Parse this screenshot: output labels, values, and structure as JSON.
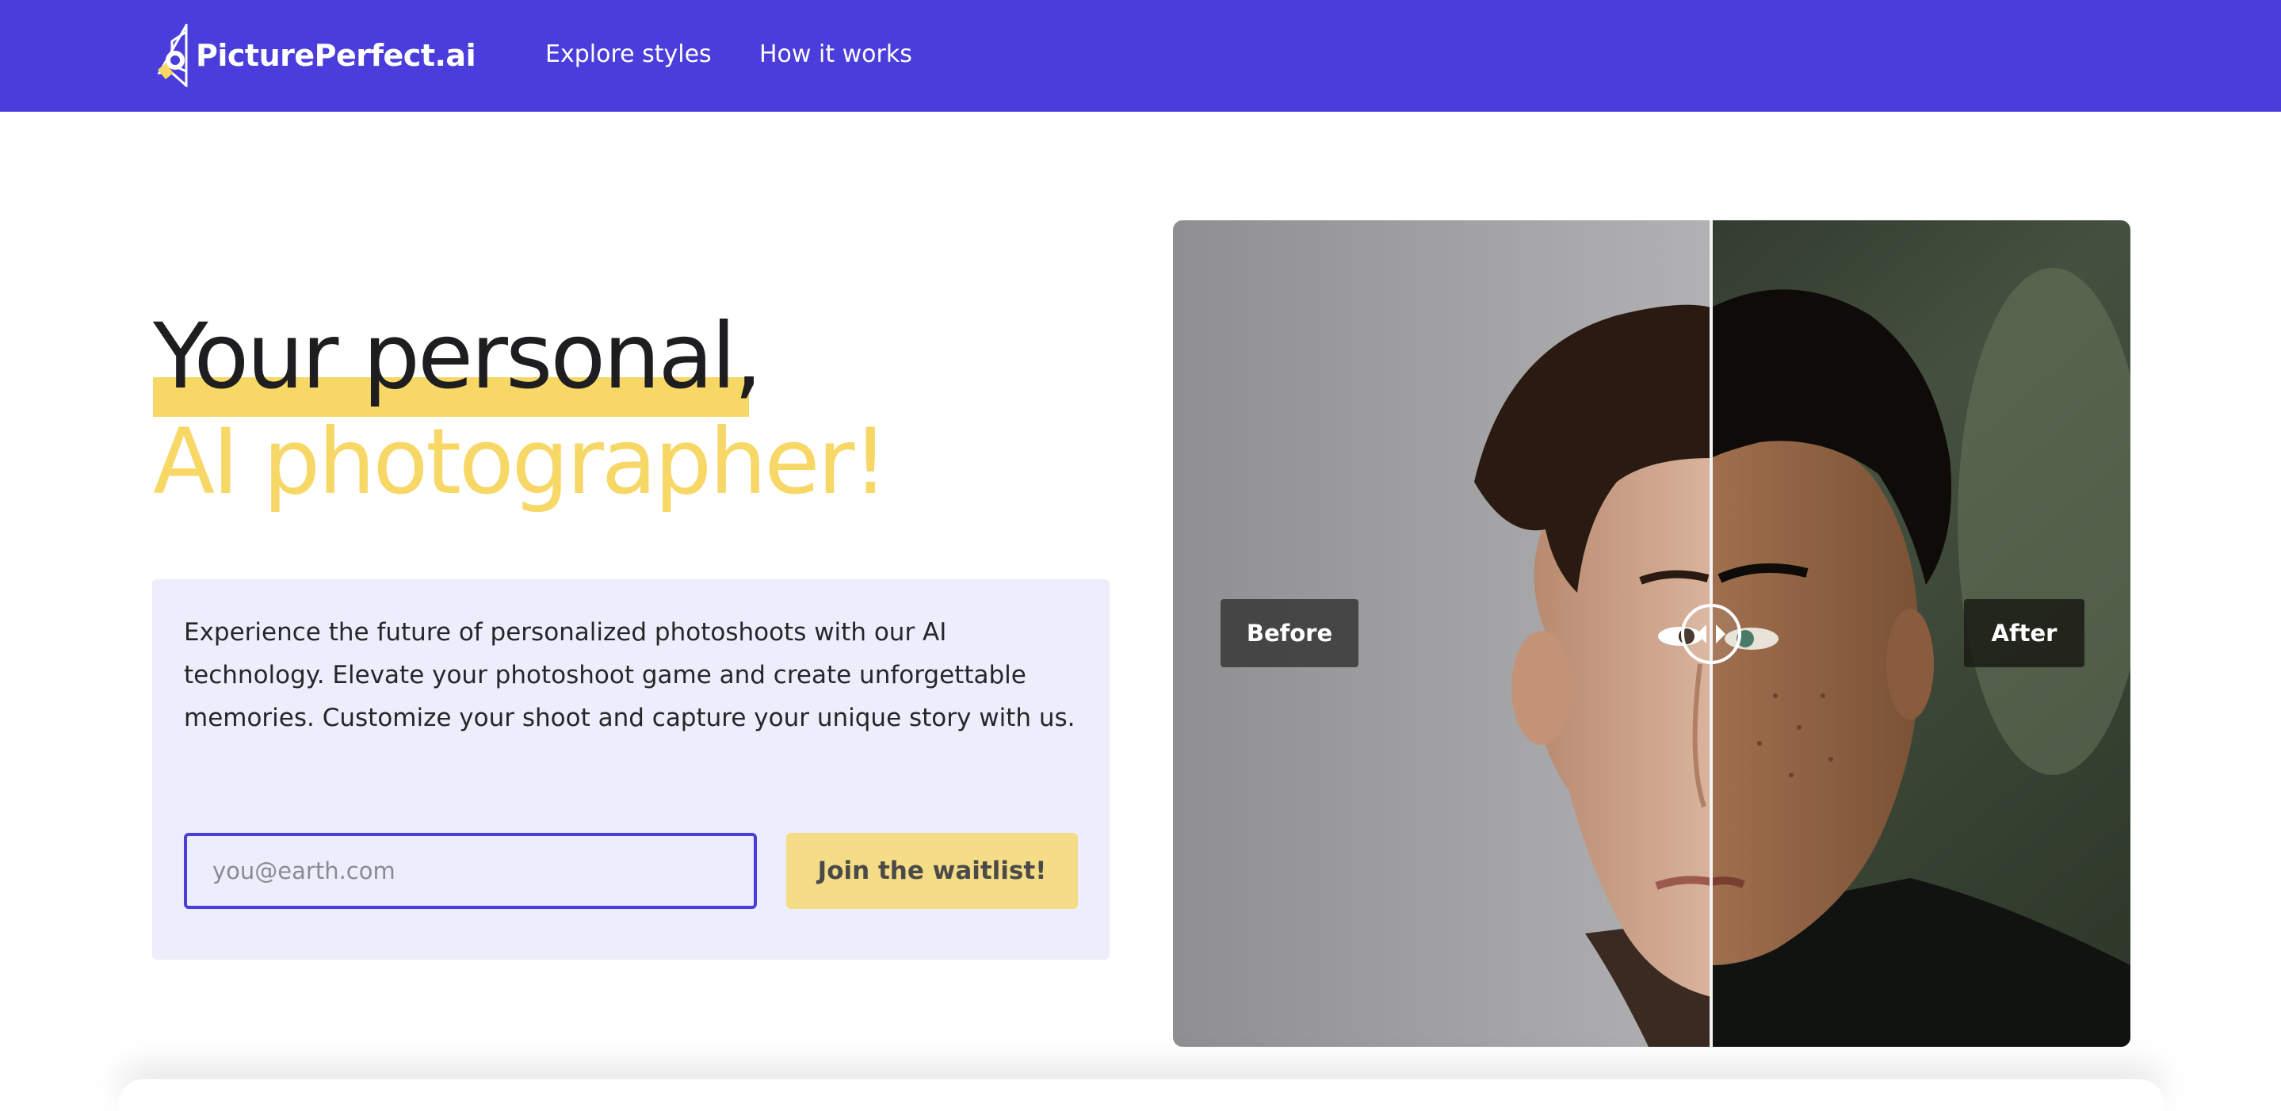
{
  "nav": {
    "brand": "PicturePerfect.ai",
    "brand_icon": "camera-flash-logo-icon",
    "links": [
      {
        "label": "Explore styles"
      },
      {
        "label": "How it works"
      }
    ]
  },
  "hero": {
    "line1": "Your personal,",
    "line2": "AI photographer!",
    "description": "Experience the future of personalized photoshoots with our AI technology. Elevate your photoshoot game and create unforgettable memories. Customize your shoot and capture your unique story with us.",
    "email_placeholder": "you@earth.com",
    "email_value": "",
    "cta_label": "Join the waitlist!"
  },
  "comparison": {
    "before_label": "Before",
    "after_label": "After",
    "handle_icon": "arrows-left-right-icon"
  },
  "colors": {
    "brand_purple": "#4a3ddc",
    "accent_yellow": "#f7d765",
    "card_bg": "#edeefb",
    "button_yellow": "#f5dc86"
  }
}
